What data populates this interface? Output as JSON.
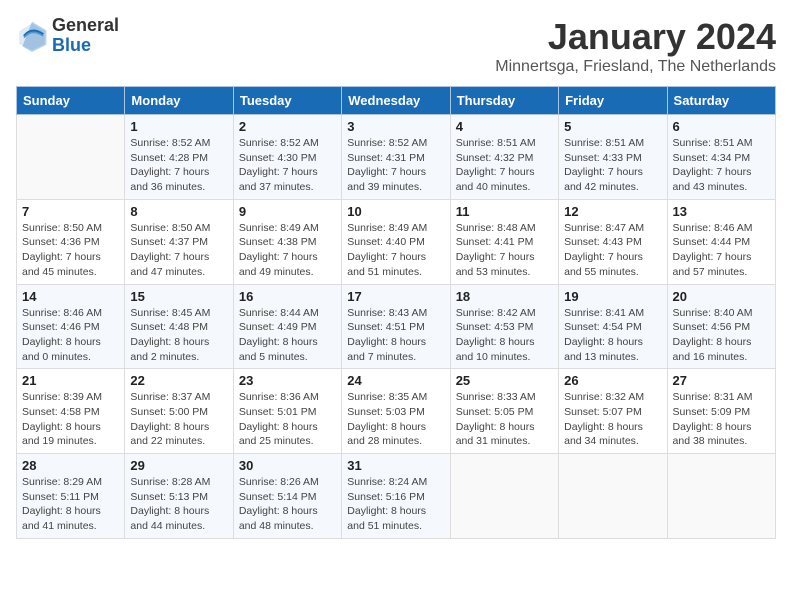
{
  "logo": {
    "general": "General",
    "blue": "Blue"
  },
  "header": {
    "month": "January 2024",
    "location": "Minnertsga, Friesland, The Netherlands"
  },
  "weekdays": [
    "Sunday",
    "Monday",
    "Tuesday",
    "Wednesday",
    "Thursday",
    "Friday",
    "Saturday"
  ],
  "weeks": [
    [
      {
        "day": "",
        "info": ""
      },
      {
        "day": "1",
        "info": "Sunrise: 8:52 AM\nSunset: 4:28 PM\nDaylight: 7 hours\nand 36 minutes."
      },
      {
        "day": "2",
        "info": "Sunrise: 8:52 AM\nSunset: 4:30 PM\nDaylight: 7 hours\nand 37 minutes."
      },
      {
        "day": "3",
        "info": "Sunrise: 8:52 AM\nSunset: 4:31 PM\nDaylight: 7 hours\nand 39 minutes."
      },
      {
        "day": "4",
        "info": "Sunrise: 8:51 AM\nSunset: 4:32 PM\nDaylight: 7 hours\nand 40 minutes."
      },
      {
        "day": "5",
        "info": "Sunrise: 8:51 AM\nSunset: 4:33 PM\nDaylight: 7 hours\nand 42 minutes."
      },
      {
        "day": "6",
        "info": "Sunrise: 8:51 AM\nSunset: 4:34 PM\nDaylight: 7 hours\nand 43 minutes."
      }
    ],
    [
      {
        "day": "7",
        "info": "Sunrise: 8:50 AM\nSunset: 4:36 PM\nDaylight: 7 hours\nand 45 minutes."
      },
      {
        "day": "8",
        "info": "Sunrise: 8:50 AM\nSunset: 4:37 PM\nDaylight: 7 hours\nand 47 minutes."
      },
      {
        "day": "9",
        "info": "Sunrise: 8:49 AM\nSunset: 4:38 PM\nDaylight: 7 hours\nand 49 minutes."
      },
      {
        "day": "10",
        "info": "Sunrise: 8:49 AM\nSunset: 4:40 PM\nDaylight: 7 hours\nand 51 minutes."
      },
      {
        "day": "11",
        "info": "Sunrise: 8:48 AM\nSunset: 4:41 PM\nDaylight: 7 hours\nand 53 minutes."
      },
      {
        "day": "12",
        "info": "Sunrise: 8:47 AM\nSunset: 4:43 PM\nDaylight: 7 hours\nand 55 minutes."
      },
      {
        "day": "13",
        "info": "Sunrise: 8:46 AM\nSunset: 4:44 PM\nDaylight: 7 hours\nand 57 minutes."
      }
    ],
    [
      {
        "day": "14",
        "info": "Sunrise: 8:46 AM\nSunset: 4:46 PM\nDaylight: 8 hours\nand 0 minutes."
      },
      {
        "day": "15",
        "info": "Sunrise: 8:45 AM\nSunset: 4:48 PM\nDaylight: 8 hours\nand 2 minutes."
      },
      {
        "day": "16",
        "info": "Sunrise: 8:44 AM\nSunset: 4:49 PM\nDaylight: 8 hours\nand 5 minutes."
      },
      {
        "day": "17",
        "info": "Sunrise: 8:43 AM\nSunset: 4:51 PM\nDaylight: 8 hours\nand 7 minutes."
      },
      {
        "day": "18",
        "info": "Sunrise: 8:42 AM\nSunset: 4:53 PM\nDaylight: 8 hours\nand 10 minutes."
      },
      {
        "day": "19",
        "info": "Sunrise: 8:41 AM\nSunset: 4:54 PM\nDaylight: 8 hours\nand 13 minutes."
      },
      {
        "day": "20",
        "info": "Sunrise: 8:40 AM\nSunset: 4:56 PM\nDaylight: 8 hours\nand 16 minutes."
      }
    ],
    [
      {
        "day": "21",
        "info": "Sunrise: 8:39 AM\nSunset: 4:58 PM\nDaylight: 8 hours\nand 19 minutes."
      },
      {
        "day": "22",
        "info": "Sunrise: 8:37 AM\nSunset: 5:00 PM\nDaylight: 8 hours\nand 22 minutes."
      },
      {
        "day": "23",
        "info": "Sunrise: 8:36 AM\nSunset: 5:01 PM\nDaylight: 8 hours\nand 25 minutes."
      },
      {
        "day": "24",
        "info": "Sunrise: 8:35 AM\nSunset: 5:03 PM\nDaylight: 8 hours\nand 28 minutes."
      },
      {
        "day": "25",
        "info": "Sunrise: 8:33 AM\nSunset: 5:05 PM\nDaylight: 8 hours\nand 31 minutes."
      },
      {
        "day": "26",
        "info": "Sunrise: 8:32 AM\nSunset: 5:07 PM\nDaylight: 8 hours\nand 34 minutes."
      },
      {
        "day": "27",
        "info": "Sunrise: 8:31 AM\nSunset: 5:09 PM\nDaylight: 8 hours\nand 38 minutes."
      }
    ],
    [
      {
        "day": "28",
        "info": "Sunrise: 8:29 AM\nSunset: 5:11 PM\nDaylight: 8 hours\nand 41 minutes."
      },
      {
        "day": "29",
        "info": "Sunrise: 8:28 AM\nSunset: 5:13 PM\nDaylight: 8 hours\nand 44 minutes."
      },
      {
        "day": "30",
        "info": "Sunrise: 8:26 AM\nSunset: 5:14 PM\nDaylight: 8 hours\nand 48 minutes."
      },
      {
        "day": "31",
        "info": "Sunrise: 8:24 AM\nSunset: 5:16 PM\nDaylight: 8 hours\nand 51 minutes."
      },
      {
        "day": "",
        "info": ""
      },
      {
        "day": "",
        "info": ""
      },
      {
        "day": "",
        "info": ""
      }
    ]
  ]
}
